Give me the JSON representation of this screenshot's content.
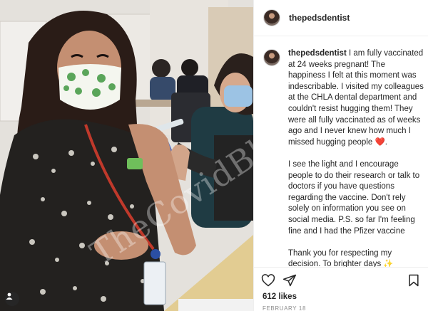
{
  "post": {
    "username": "thepedsdentist",
    "caption_paragraphs": [
      "I am fully vaccinated at 24 weeks pregnant! The happiness I felt at this moment was indescribable. I visited my colleagues at the CHLA dental department and couldn't resist hugging them! They were all fully vaccinated as of weeks ago and I never knew how much I missed hugging people ❤️.",
      "I see the light and I encourage people to do their research or talk to doctors if you have questions regarding the vaccine. Don't rely solely on information you see on social media. P.S. so far I'm feeling fine and I had the Pfizer vaccine",
      "Thank you for respecting my decision. To brighter days ✨"
    ],
    "trailing_dots": [
      ".",
      "."
    ],
    "likes": "612 likes",
    "date": "FEBRUARY 18"
  },
  "photo": {
    "watermark": "TheCovidBlog.com"
  },
  "icons": {
    "like": "heart-icon",
    "share": "paper-plane-icon",
    "save": "bookmark-icon",
    "tag": "person-tag-icon"
  },
  "colors": {
    "text": "#262626",
    "muted": "#8e8e8e",
    "border": "#efefef",
    "mask_green": "#5aa55a"
  }
}
